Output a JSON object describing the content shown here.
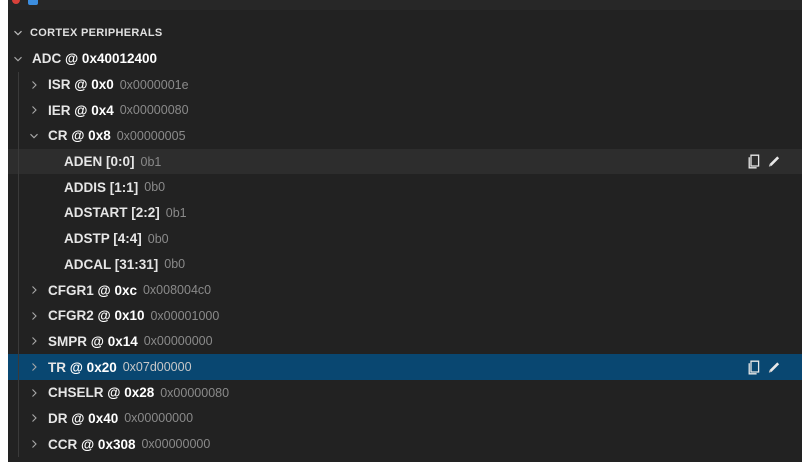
{
  "colors": {
    "panel_bg": "#222222",
    "selected_bg": "#094771",
    "hover_bg": "#2d2d2d",
    "label": "#e6e6e6",
    "value": "#8a8a8a"
  },
  "section": {
    "title": "CORTEX PERIPHERALS",
    "expanded": true
  },
  "peripheral": {
    "label": "ADC",
    "addr": "@ 0x40012400",
    "expanded": true
  },
  "registers": [
    {
      "label": "ISR",
      "addr": "@ 0x0",
      "value": "0x0000001e",
      "expanded": false
    },
    {
      "label": "IER",
      "addr": "@ 0x4",
      "value": "0x00000080",
      "expanded": false
    },
    {
      "label": "CR",
      "addr": "@ 0x8",
      "value": "0x00000005",
      "expanded": true,
      "fields": [
        {
          "label": "ADEN [0:0]",
          "value": "0b1",
          "hover": true
        },
        {
          "label": "ADDIS [1:1]",
          "value": "0b0"
        },
        {
          "label": "ADSTART [2:2]",
          "value": "0b1"
        },
        {
          "label": "ADSTP [4:4]",
          "value": "0b0"
        },
        {
          "label": "ADCAL [31:31]",
          "value": "0b0"
        }
      ]
    },
    {
      "label": "CFGR1",
      "addr": "@ 0xc",
      "value": "0x008004c0",
      "expanded": false
    },
    {
      "label": "CFGR2",
      "addr": "@ 0x10",
      "value": "0x00001000",
      "expanded": false
    },
    {
      "label": "SMPR",
      "addr": "@ 0x14",
      "value": "0x00000000",
      "expanded": false
    },
    {
      "label": "TR",
      "addr": "@ 0x20",
      "value": "0x07d00000",
      "expanded": false,
      "selected": true
    },
    {
      "label": "CHSELR",
      "addr": "@ 0x28",
      "value": "0x00000080",
      "expanded": false
    },
    {
      "label": "DR",
      "addr": "@ 0x40",
      "value": "0x00000000",
      "expanded": false
    },
    {
      "label": "CCR",
      "addr": "@ 0x308",
      "value": "0x00000000",
      "expanded": false
    }
  ],
  "icons": {
    "copy": "copy-icon",
    "edit": "pencil-icon",
    "expand": "chevron-right-icon",
    "collapse": "chevron-down-icon"
  }
}
